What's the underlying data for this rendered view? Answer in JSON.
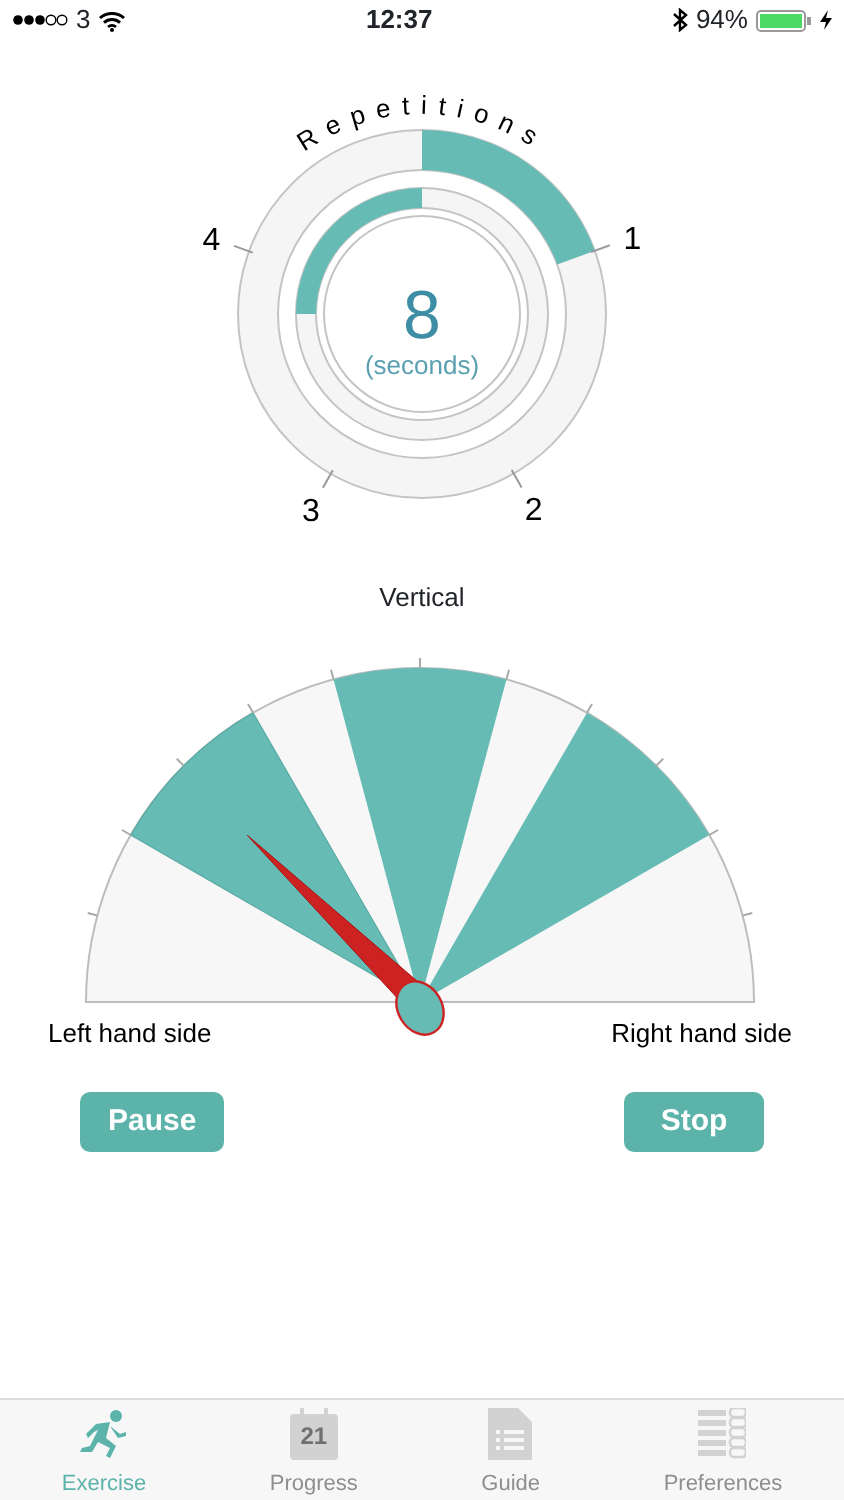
{
  "status_bar": {
    "carrier": "3",
    "time": "12:37",
    "battery": "94%"
  },
  "repetitions": {
    "title": "Repetitions",
    "marks": [
      {
        "label": "1",
        "reached": true
      },
      {
        "label": "2",
        "reached": false
      },
      {
        "label": "3",
        "reached": false
      },
      {
        "label": "4",
        "reached": false
      }
    ]
  },
  "timer": {
    "value": "8",
    "unit": "(seconds)",
    "level": 0.25
  },
  "gauge": {
    "top_label": "Vertical",
    "left_label": "Left hand side",
    "right_label": "Right hand side",
    "zones": [
      {
        "pointed": true
      },
      {
        "pointed": false
      },
      {
        "pointed": false
      }
    ]
  },
  "buttons": [
    {
      "label": "Pause"
    },
    {
      "label": "Stop"
    }
  ],
  "tabs": [
    {
      "label": "Exercise",
      "kind": "runner",
      "selected": true
    },
    {
      "label": "Progress",
      "kind": "calendar",
      "icon_text": "21",
      "selected": false
    },
    {
      "label": "Guide",
      "kind": "document",
      "selected": false
    },
    {
      "label": "Preferences",
      "kind": "list",
      "selected": false
    }
  ]
}
